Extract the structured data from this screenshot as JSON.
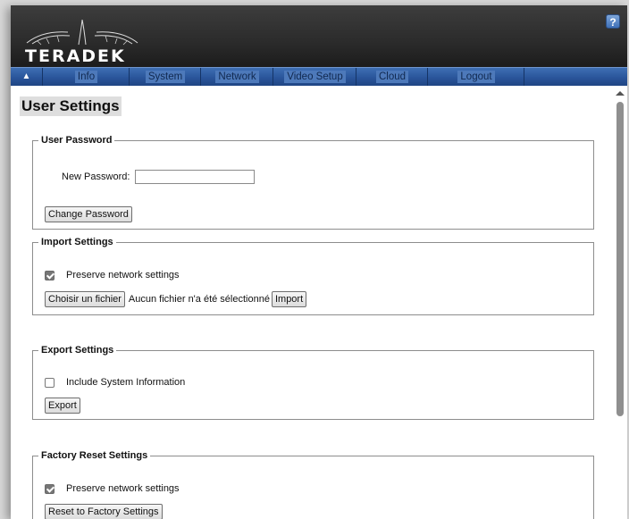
{
  "header": {
    "brand": "TERADEK",
    "help_label": "?"
  },
  "nav": {
    "home_icon": "home-icon",
    "items": [
      "Info",
      "System",
      "Network",
      "Video Setup",
      "Cloud",
      "Logout"
    ]
  },
  "page": {
    "title": "User Settings"
  },
  "user_password": {
    "legend": "User Password",
    "new_password_label": "New Password:",
    "new_password_value": "",
    "change_button": "Change Password"
  },
  "import_settings": {
    "legend": "Import Settings",
    "preserve_label": "Preserve network settings",
    "preserve_checked": true,
    "choose_file_button": "Choisir un fichier",
    "no_file_text": "Aucun fichier n'a été sélectionné",
    "import_button": "Import"
  },
  "export_settings": {
    "legend": "Export Settings",
    "include_label": "Include System Information",
    "include_checked": false,
    "export_button": "Export"
  },
  "factory_reset": {
    "legend": "Factory Reset Settings",
    "preserve_label": "Preserve network settings",
    "preserve_checked": true,
    "reset_button": "Reset to Factory Settings"
  },
  "colors": {
    "nav_blue": "#2a559a",
    "header_dark": "#2b2b2b"
  }
}
